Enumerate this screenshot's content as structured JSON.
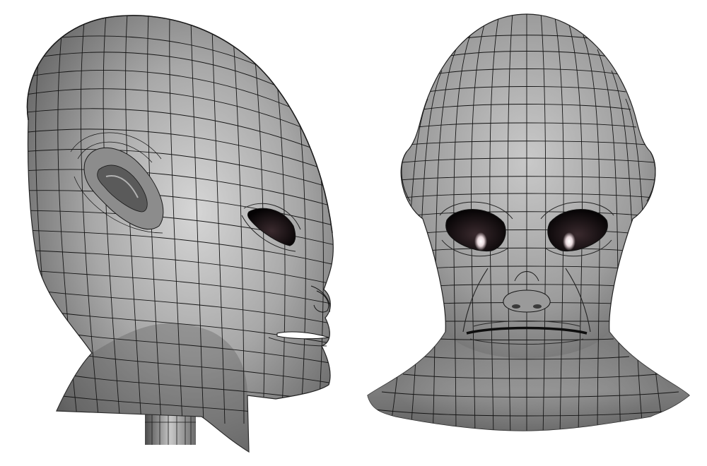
{
  "image": {
    "subject": "wireframe-mesh-alien-head",
    "views": [
      {
        "id": "side-view",
        "facing": "right"
      },
      {
        "id": "front-view",
        "facing": "viewer"
      }
    ],
    "colors": {
      "background": "#ffffff",
      "skin_light": "#d2d2d2",
      "skin_mid": "#9a9a9a",
      "skin_dark": "#3a3a3a",
      "wire": "#151515",
      "eye": "#080405",
      "eye_highlight": "#f4e6ea"
    }
  }
}
